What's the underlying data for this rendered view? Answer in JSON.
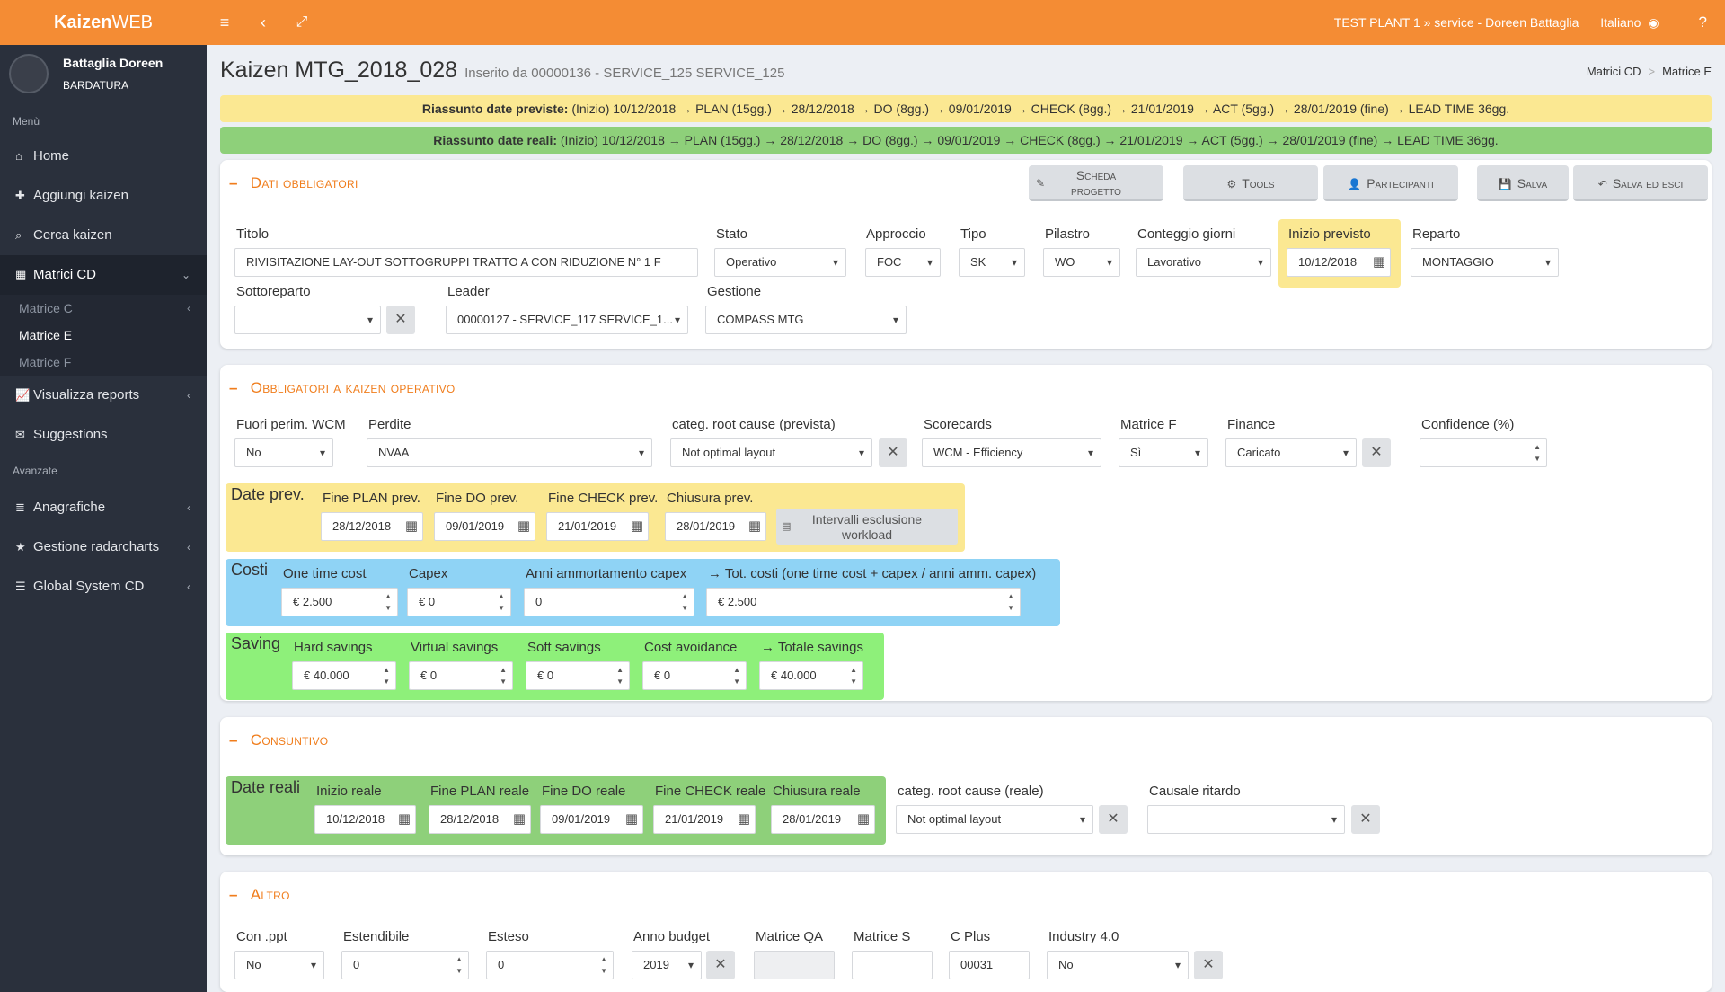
{
  "topbar": {
    "brand_bold": "Kaizen",
    "brand_light": "WEB",
    "context": "TEST PLANT 1 » service - Doreen Battaglia",
    "language": "Italiano",
    "help": "?"
  },
  "sidebar": {
    "user_name": "Battaglia Doreen",
    "user_role": "BARDATURA",
    "menu_label": "Menù",
    "advanced_label": "Avanzate",
    "items": [
      {
        "label": "Home",
        "icon": "home-icon"
      },
      {
        "label": "Aggiungi kaizen",
        "icon": "plus-icon"
      },
      {
        "label": "Cerca kaizen",
        "icon": "search-icon"
      },
      {
        "label": "Matrici CD",
        "icon": "table-icon"
      },
      {
        "label": "Visualizza reports",
        "icon": "chart-icon"
      },
      {
        "label": "Suggestions",
        "icon": "envelope-icon"
      },
      {
        "label": "Anagrafiche",
        "icon": "database-icon"
      },
      {
        "label": "Gestione radarcharts",
        "icon": "star-icon"
      },
      {
        "label": "Global System CD",
        "icon": "sliders-icon"
      }
    ],
    "subitems": [
      "Matrice C",
      "Matrice E",
      "Matrice F"
    ]
  },
  "page": {
    "title": "Kaizen MTG_2018_028",
    "subtitle": "Inserito da 00000136 - SERVICE_125 SERVICE_125",
    "breadcrumb": [
      "Matrici CD",
      "Matrice E"
    ]
  },
  "banners": {
    "prev_label": "Riassunto date previste:",
    "prev_text": "(Inizio) 10/12/2018 → PLAN (15gg.) → 28/12/2018 → DO (8gg.) → 09/01/2019 → CHECK (8gg.) → 21/01/2019 → ACT (5gg.) → 28/01/2019 (fine) → LEAD TIME 36gg.",
    "real_label": "Riassunto date reali:",
    "real_text": "(Inizio) 10/12/2018 → PLAN (15gg.) → 28/12/2018 → DO (8gg.) → 09/01/2019 → CHECK (8gg.) → 21/01/2019 → ACT (5gg.) → 28/01/2019 (fine) → LEAD TIME 36gg."
  },
  "dati": {
    "title": "Dati obbligatori",
    "buttons": {
      "scheda_1": "Scheda",
      "scheda_2": "progetto",
      "tools": "Tools",
      "partecipanti": "Partecipanti",
      "salva": "Salva",
      "salva_esci": "Salva ed esci"
    },
    "titolo_label": "Titolo",
    "titolo_value": "RIVISITAZIONE LAY-OUT SOTTOGRUPPI TRATTO A CON RIDUZIONE N° 1 F",
    "stato_label": "Stato",
    "stato_value": "Operativo",
    "approccio_label": "Approccio",
    "approccio_value": "FOC",
    "tipo_label": "Tipo",
    "tipo_value": "SK",
    "pilastro_label": "Pilastro",
    "pilastro_value": "WO",
    "conteggio_label": "Conteggio giorni",
    "conteggio_value": "Lavorativo",
    "inizio_label": "Inizio previsto",
    "inizio_value": "10/12/2018",
    "reparto_label": "Reparto",
    "reparto_value": "MONTAGGIO",
    "sottoreparto_label": "Sottoreparto",
    "sottoreparto_value": "",
    "leader_label": "Leader",
    "leader_value": "00000127 - SERVICE_117 SERVICE_1...",
    "gestione_label": "Gestione",
    "gestione_value": "COMPASS MTG"
  },
  "operativo": {
    "title": "Obbligatori a kaizen operativo",
    "fuori_label": "Fuori perim. WCM",
    "fuori_value": "No",
    "perdite_label": "Perdite",
    "perdite_value": "NVAA",
    "categ_label": "categ. root cause (prevista)",
    "categ_value": "Not optimal layout",
    "scorecards_label": "Scorecards",
    "scorecards_value": "WCM - Efficiency",
    "matricef_label": "Matrice F",
    "matricef_value": "Sì",
    "finance_label": "Finance",
    "finance_value": "Caricato",
    "confidence_label": "Confidence (%)",
    "confidence_value": "",
    "dateprev": {
      "title": "Date prev.",
      "fine_plan_label": "Fine PLAN prev.",
      "fine_plan_value": "28/12/2018",
      "fine_do_label": "Fine DO prev.",
      "fine_do_value": "09/01/2019",
      "fine_check_label": "Fine CHECK prev.",
      "fine_check_value": "21/01/2019",
      "chiusura_label": "Chiusura prev.",
      "chiusura_value": "28/01/2019",
      "intervalli_1": "Intervalli esclusione",
      "intervalli_2": "workload"
    },
    "costi": {
      "title": "Costi",
      "one_label": "One time cost",
      "one_value": "€ 2.500",
      "capex_label": "Capex",
      "capex_value": "€ 0",
      "anni_label": "Anni ammortamento capex",
      "anni_value": "0",
      "tot_label": "→ Tot. costi (one time cost + capex / anni amm. capex)",
      "tot_value": "€ 2.500"
    },
    "saving": {
      "title": "Saving",
      "hard_label": "Hard savings",
      "hard_value": "€ 40.000",
      "virtual_label": "Virtual savings",
      "virtual_value": "€ 0",
      "soft_label": "Soft savings",
      "soft_value": "€ 0",
      "cost_label": "Cost avoidance",
      "cost_value": "€ 0",
      "tot_label": "→ Totale savings",
      "tot_value": "€ 40.000"
    }
  },
  "consuntivo": {
    "title": "Consuntivo",
    "zone_title": "Date reali",
    "inizio_label": "Inizio reale",
    "inizio_value": "10/12/2018",
    "plan_label": "Fine PLAN reale",
    "plan_value": "28/12/2018",
    "do_label": "Fine DO reale",
    "do_value": "09/01/2019",
    "check_label": "Fine CHECK reale",
    "check_value": "21/01/2019",
    "chiusura_label": "Chiusura reale",
    "chiusura_value": "28/01/2019",
    "categ_label": "categ. root cause (reale)",
    "categ_value": "Not optimal layout",
    "causale_label": "Causale ritardo",
    "causale_value": ""
  },
  "altro": {
    "title": "Altro",
    "ppt_label": "Con .ppt",
    "ppt_value": "No",
    "estendibile_label": "Estendibile",
    "estendibile_value": "0",
    "esteso_label": "Esteso",
    "esteso_value": "0",
    "anno_label": "Anno budget",
    "anno_value": "2019",
    "qa_label": "Matrice QA",
    "qa_value": "",
    "s_label": "Matrice S",
    "s_value": "",
    "cplus_label": "C Plus",
    "cplus_value": "00031",
    "industry_label": "Industry 4.0",
    "industry_value": "No"
  },
  "colors": {
    "accent": "#f48c34",
    "sidebar": "#2a303c",
    "prev": "#fbe892",
    "real": "#8ed07a",
    "costi": "#8fd3f5",
    "saving": "#8ef07a"
  }
}
